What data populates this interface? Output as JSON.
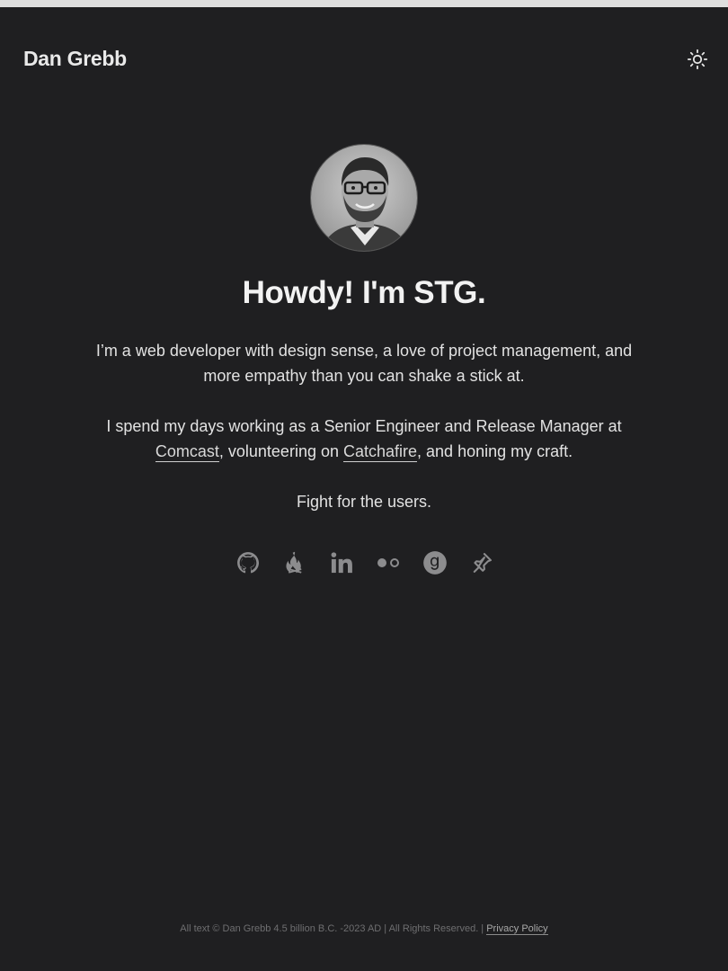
{
  "header": {
    "brand": "Dan Grebb",
    "theme_toggle_icon": "sun-icon"
  },
  "hero": {
    "avatar_icon": "avatar-photo",
    "headline": "Howdy! I'm STG.",
    "intro": "I’m a web developer with design sense, a love of project management, and more empathy than you can shake a stick at.",
    "work_prefix": "I spend my days working as a Senior Engineer and Release Manager at ",
    "work_link_comcast": "Comcast",
    "work_middle": ", volunteering on ",
    "work_link_catchafire": "Catchafire",
    "work_suffix": ", and honing my craft.",
    "motto": "Fight for the users."
  },
  "socials": [
    {
      "icon": "github-icon"
    },
    {
      "icon": "campfire-icon"
    },
    {
      "icon": "linkedin-icon"
    },
    {
      "icon": "flickr-icon"
    },
    {
      "icon": "goodreads-icon"
    },
    {
      "icon": "pin-icon"
    }
  ],
  "colors": {
    "background": "#1f1f21",
    "text": "#e8e8e8",
    "icon": "#8c8c8e",
    "footer_text": "#6e6e70"
  },
  "footer": {
    "copyright": "All text © Dan Grebb 4.5 billion B.C. -2023 AD | All Rights Reserved. | ",
    "privacy_link": "Privacy Policy"
  }
}
